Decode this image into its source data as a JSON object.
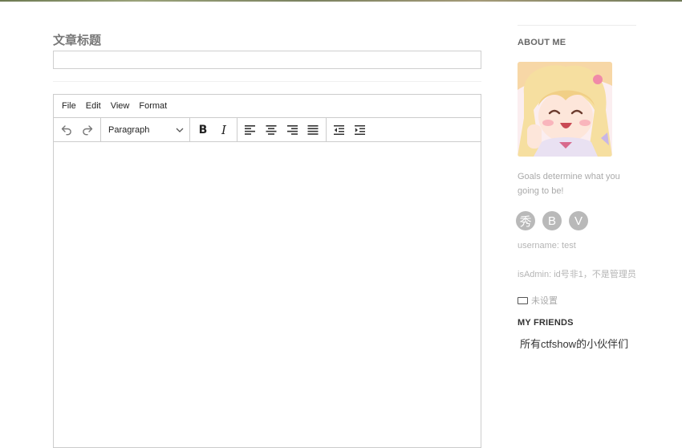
{
  "post": {
    "title_label": "文章标题",
    "title_value": ""
  },
  "editor": {
    "menu": [
      "File",
      "Edit",
      "View",
      "Format"
    ],
    "block_format": "Paragraph",
    "bold_label": "B",
    "italic_label": "I",
    "icons": [
      "undo-icon",
      "redo-icon",
      "chevron-down-icon",
      "align-left-icon",
      "align-center-icon",
      "align-right-icon",
      "align-justify-icon",
      "outdent-icon",
      "indent-icon"
    ]
  },
  "sidebar": {
    "about_heading": "ABOUT ME",
    "motto": "Goals determine what you going to be!",
    "socials": [
      "秀",
      "B",
      "V"
    ],
    "username_line": "username: test",
    "admin_line": "isAdmin: id号非1，不是管理员",
    "unset_text": "未设置",
    "friends_heading": "MY FRIENDS",
    "friends_link": "所有ctfshow的小伙伴们"
  },
  "colors": {
    "social_bg": "#b9b9b9",
    "border": "#cccccc"
  }
}
